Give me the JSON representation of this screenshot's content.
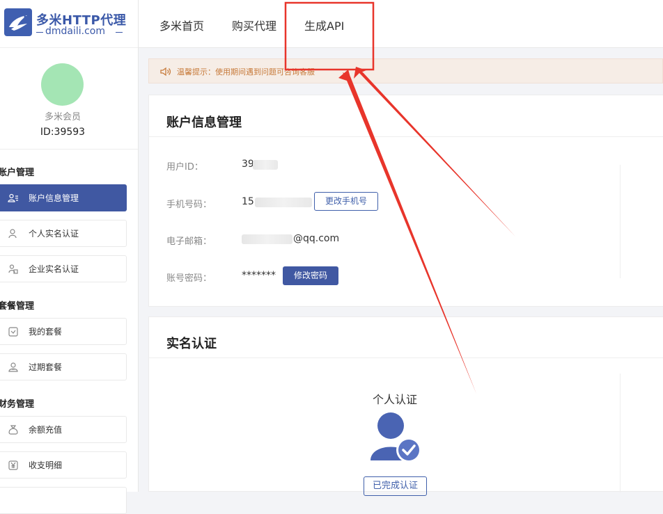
{
  "brand": {
    "title": "多米HTTP代理",
    "domain": "dmdaili.com"
  },
  "user": {
    "member_label": "多米会员",
    "id_label": "ID:39593"
  },
  "sidebar": {
    "groups": [
      {
        "title": "账户管理",
        "items": [
          {
            "label": "账户信息管理",
            "icon": "user-card-icon",
            "active": true
          },
          {
            "label": "个人实名认证",
            "icon": "person-icon",
            "active": false
          },
          {
            "label": "企业实名认证",
            "icon": "enterprise-icon",
            "active": false
          }
        ]
      },
      {
        "title": "套餐管理",
        "items": [
          {
            "label": "我的套餐",
            "icon": "package-icon",
            "active": false
          },
          {
            "label": "过期套餐",
            "icon": "expired-icon",
            "active": false
          }
        ]
      },
      {
        "title": "财务管理",
        "items": [
          {
            "label": "余额充值",
            "icon": "money-bag-icon",
            "active": false
          },
          {
            "label": "收支明细",
            "icon": "yen-icon",
            "active": false
          }
        ]
      }
    ]
  },
  "nav": {
    "items": [
      "多米首页",
      "购买代理",
      "生成API"
    ]
  },
  "notice": {
    "text": "温馨提示：使用期间遇到问题可咨询客服"
  },
  "account": {
    "title": "账户信息管理",
    "fields": {
      "user_id": {
        "label": "用户ID：",
        "value": "39"
      },
      "phone": {
        "label": "手机号码：",
        "value": "15",
        "button": "更改手机号"
      },
      "email": {
        "label": "电子邮箱：",
        "value": "@qq.com"
      },
      "password": {
        "label": "账号密码：",
        "value": "*******",
        "button": "修改密码"
      }
    }
  },
  "realname": {
    "title": "实名认证",
    "personal": {
      "title": "个人认证",
      "status_button": "已完成认证"
    }
  },
  "colors": {
    "brand": "#3f5fb0",
    "active_menu": "#4058a2",
    "avatar": "#a4e5b4",
    "notice_bg": "#f6ede6",
    "notice_text": "#c77a3a",
    "annotation_red": "#e8352b"
  }
}
